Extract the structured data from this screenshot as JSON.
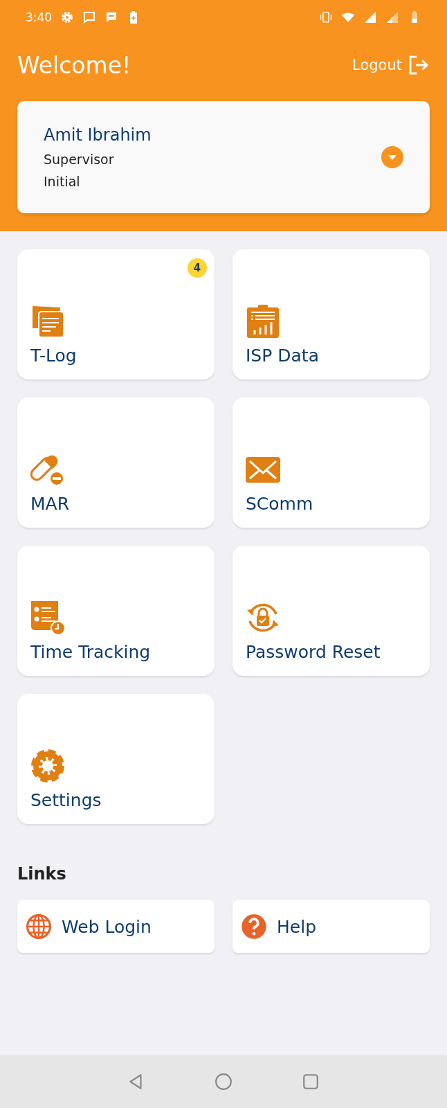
{
  "status_bar": {
    "time": "3:40"
  },
  "header": {
    "title": "Welcome!",
    "logout": "Logout"
  },
  "user_card": {
    "name": "Amit Ibrahim",
    "role": "Supervisor",
    "status": "Initial"
  },
  "tiles": [
    {
      "kind": "notes",
      "label": "T-Log",
      "badge": "4"
    },
    {
      "kind": "clipboard",
      "label": "ISP Data"
    },
    {
      "kind": "pill",
      "label": "MAR"
    },
    {
      "kind": "mail",
      "label": "SComm"
    },
    {
      "kind": "timesheet",
      "label": "Time Tracking"
    },
    {
      "kind": "lock",
      "label": "Password Reset"
    },
    {
      "kind": "gear",
      "label": "Settings"
    }
  ],
  "links": {
    "title": "Links",
    "items": [
      {
        "kind": "globe",
        "label": "Web Login"
      },
      {
        "kind": "help",
        "label": "Help"
      }
    ]
  }
}
